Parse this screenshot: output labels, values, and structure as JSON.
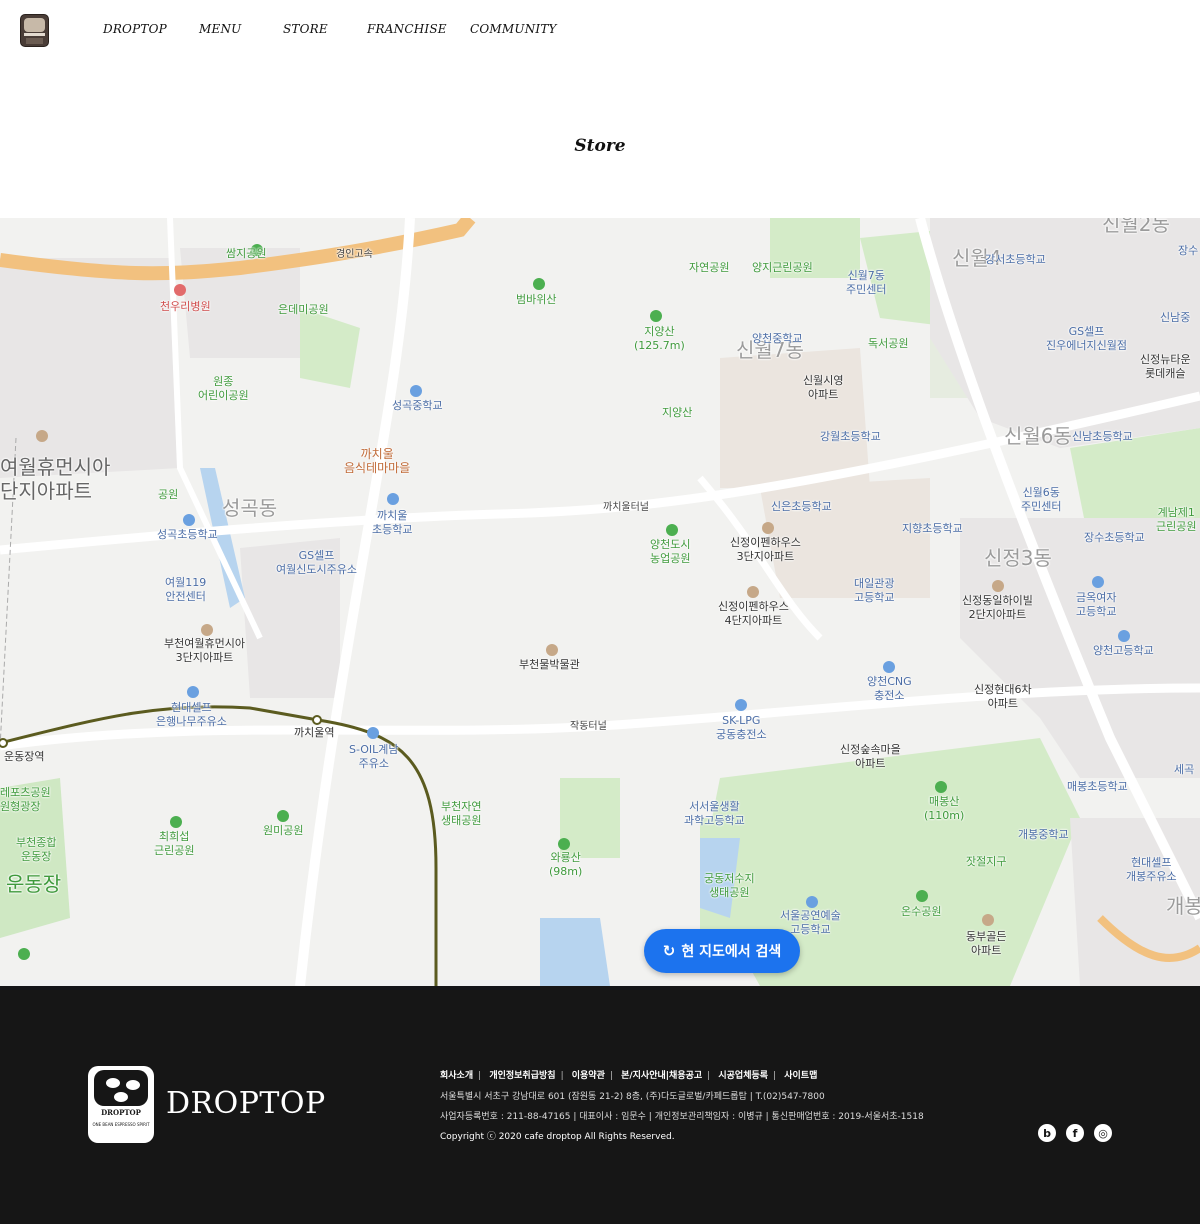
{
  "header": {
    "nav": [
      "DROPTOP",
      "MENU",
      "STORE",
      "FRANCHISE",
      "COMMUNITY"
    ]
  },
  "page": {
    "title": "Store"
  },
  "map": {
    "search_button": "현 지도에서 검색",
    "labels": {
      "gyeongin": "경인고속",
      "ssamji": "쌈지공원",
      "cheonwoori": "천우리병원",
      "eundaemi": "은데미공원",
      "wonjong": "원종\n어린이공원",
      "beombawi": "범바위산",
      "jayeon": "자연공원",
      "yangji": "양지근린공원",
      "sinwol7_center": "신월7동\n주민센터",
      "sinwol4_big": "신월4",
      "gangseo_school": "강서초등학교",
      "jiyangsan_h": "지양산\n(125.7m)",
      "sinwol7_big": "신월7동",
      "yangcheon_mid": "양천중학교",
      "dokseo": "독서공원",
      "gs_jinwoo": "GS셀프\n진우에너지신월점",
      "sinjeong_newtown": "신정뉴타운\n롯데캐슬",
      "sinnam_top": "신남중",
      "sinwol_siyoung": "신월시영\n아파트",
      "seonggok_mid": "성곡중학교",
      "jiyangsan": "지양산",
      "gangwol": "강월초등학교",
      "sinwol6_big": "신월6동",
      "sinnam_school": "신남초등학교",
      "yeowol_big": "여월휴먼시아\n단지아파트",
      "kkachiul_food": "까치울\n음식테마마을",
      "gongwon_left": "공원",
      "seonggok_dong": "성곡동",
      "kkachiul_tunnel": "까치울터널",
      "sineun": "신은초등학교",
      "sinwol6_center": "신월6동\n주민센터",
      "gyenam": "계남제1\n근린공원",
      "seonggok_school": "성곡초등학교",
      "kkachiul_school": "까치울\n초등학교",
      "gs_yeowol": "GS셀프\n여월신도시주유소",
      "yangcheon_farm": "양천도시\n농업공원",
      "sinjeong_3": "신정이펜하우스\n3단지아파트",
      "jihyang": "지향초등학교",
      "sinjeong3_big": "신정3동",
      "jangsu_school": "장수초등학교",
      "yeowol119": "여월119\n안전센터",
      "daeil": "대일관광\n고등학교",
      "sinjeong_ilhai": "신정동일하이빌\n2단지아파트",
      "geumok": "금옥여자\n고등학교",
      "sinjeong_4": "신정이펜하우스\n4단지아파트",
      "bucheon_yeowol3": "부천여월휴먼시아\n3단지아파트",
      "bucheon_museum": "부천물박물관",
      "yangcheon_high": "양천고등학교",
      "yangcheon_cng": "양천CNG\n충전소",
      "sinjeong_hyundai6": "신정현대6차\n아파트",
      "hyundai_eunhaeng": "현대셀프\n은행나무주유소",
      "kkachiul_station": "까치울역",
      "jakdong_tunnel": "작동터널",
      "sk_lpg": "SK-LPG\n궁동충전소",
      "undong_station": "운동장역",
      "soil": "S-OIL계남\n주유소",
      "sinjeong_forest": "신정숲속마을\n아파트",
      "sejong_right": "세곡",
      "leports": "레포츠공원\n원형광장",
      "bucheon_nature": "부천자연\n생태공원",
      "maebongsan": "매봉산\n(110m)",
      "maebong_school": "매봉초등학교",
      "seoseoul": "서서울생활\n과학고등학교",
      "gaebong_mid": "개봉중학교",
      "bucheon_sports": "부천종합\n운동장",
      "choeheuiseop": "최희섭\n근린공원",
      "wonmi": "원미공원",
      "wayongsan": "와룡산\n(98m)",
      "jatjeol": "잣절지구",
      "hyundai_gaebong": "현대셀프\n개봉주유소",
      "undongjang_big": "운동장",
      "gungdong": "궁동저수지\n생태공원",
      "seoul_art": "서울공연예술\n고등학교",
      "onsu": "온수공원",
      "dongbu": "동부골든\n아파트",
      "gaebong_big": "개봉",
      "jangsu_top": "장수",
      "sinwol2_big": "신월2동"
    }
  },
  "footer": {
    "brand": "DROPTOP",
    "logo_text": "DROPTOP",
    "logo_sub": "ONE BEAN ESPRESSO SPIRIT",
    "links": [
      "회사소개",
      "개인정보취급방침",
      "이용약관",
      "본/지사안내|채용공고",
      "시공업체등록",
      "사이트맵"
    ],
    "address": "서울특별시 서초구 강남대로 601 (잠원동 21-2) 8층, (주)다도글로벌/카페드롭탑 | T.(02)547-7800",
    "business": "사업자등록번호 : 211-88-47165 | 대표이사 : 임문수 | 개인정보관리책임자 : 이병규 | 통신판매업번호 : 2019-서울서초-1518",
    "copyright": "Copyright ⓒ 2020 cafe droptop All Rights Reserved.",
    "sns": [
      "b",
      "f",
      "◎"
    ]
  }
}
